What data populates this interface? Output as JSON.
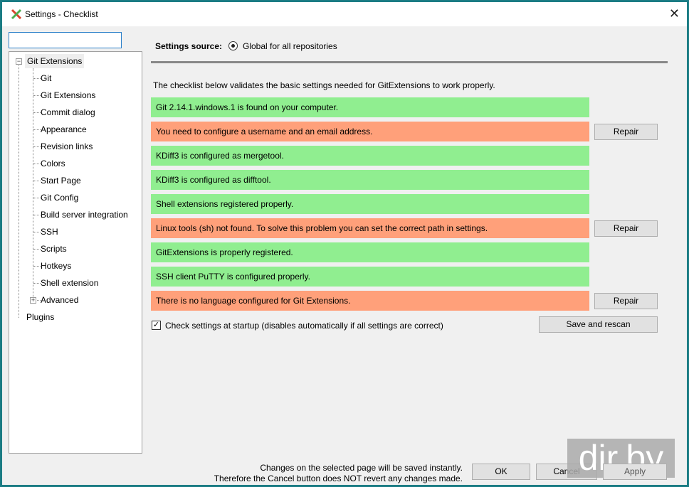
{
  "window": {
    "title": "Settings - Checklist",
    "close": "✕"
  },
  "search": {
    "value": ""
  },
  "tree": {
    "root": "Git Extensions",
    "children": [
      "Git",
      "Git Extensions",
      "Commit dialog",
      "Appearance",
      "Revision links",
      "Colors",
      "Start Page",
      "Git Config",
      "Build server integration",
      "SSH",
      "Scripts",
      "Hotkeys",
      "Shell extension",
      "Advanced"
    ],
    "plugins": "Plugins"
  },
  "source": {
    "label": "Settings source:",
    "option": "Global for all repositories"
  },
  "intro": "The checklist below validates the basic settings needed for GitExtensions to work properly.",
  "checks": [
    {
      "text": "Git 2.14.1.windows.1 is found on your computer.",
      "status": "ok"
    },
    {
      "text": "You need to configure a username and an email address.",
      "status": "bad",
      "action": "Repair"
    },
    {
      "text": "KDiff3 is configured as mergetool.",
      "status": "ok"
    },
    {
      "text": "KDiff3 is configured as difftool.",
      "status": "ok"
    },
    {
      "text": "Shell extensions registered properly.",
      "status": "ok"
    },
    {
      "text": "Linux tools (sh) not found. To solve this problem you can set the correct path in settings.",
      "status": "bad",
      "action": "Repair"
    },
    {
      "text": "GitExtensions is properly registered.",
      "status": "ok"
    },
    {
      "text": "SSH client PuTTY is configured properly.",
      "status": "ok"
    },
    {
      "text": "There is no language configured for Git Extensions.",
      "status": "bad",
      "action": "Repair"
    }
  ],
  "startup": {
    "label": "Check settings at startup (disables automatically if all settings are correct)",
    "checked": true
  },
  "save_rescan": "Save and rescan",
  "footer": {
    "line1": "Changes on the selected page will be saved instantly.",
    "line2": "Therefore the Cancel button does NOT revert any changes made.",
    "ok": "OK",
    "cancel": "Cancel",
    "apply": "Apply"
  },
  "watermark": "dir.by",
  "colors": {
    "ok": "#90ee90",
    "bad": "#ffa07a",
    "border": "#1b7c84"
  }
}
